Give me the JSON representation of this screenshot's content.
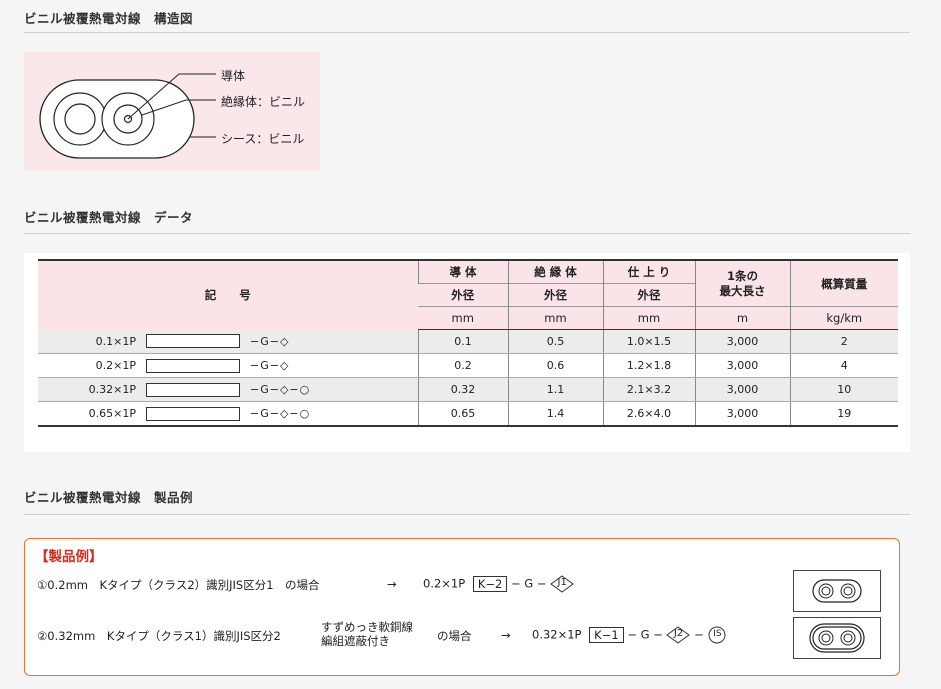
{
  "sections": {
    "structure_title": "ビニル被覆熱電対線　構造図",
    "data_title": "ビニル被覆熱電対線　データ",
    "example_title": "ビニル被覆熱電対線　製品例"
  },
  "diagram": {
    "labels": {
      "conductor": "導体",
      "insulation": "絶縁体：ビニル",
      "sheath": "シース：ビニル"
    }
  },
  "table": {
    "header": {
      "symbol": "記　　号",
      "conductor": "導 体",
      "insulation": "絶 縁 体",
      "finish": "仕 上 り",
      "max_length": "1条の\n最大長さ",
      "max_length_l1": "1条の",
      "max_length_l2": "最大長さ",
      "weight": "概算質量",
      "outer_dia": "外径",
      "unit_mm": "mm",
      "unit_m": "m",
      "unit_kgkm": "kg/km"
    },
    "rows": [
      {
        "code": "0.1×1P",
        "suffix": "−G−◇",
        "conductor": "0.1",
        "insulation": "0.5",
        "finish": "1.0×1.5",
        "length": "3,000",
        "weight": "2"
      },
      {
        "code": "0.2×1P",
        "suffix": "−G−◇",
        "conductor": "0.2",
        "insulation": "0.6",
        "finish": "1.2×1.8",
        "length": "3,000",
        "weight": "4"
      },
      {
        "code": "0.32×1P",
        "suffix": "−G−◇−○",
        "conductor": "0.32",
        "insulation": "1.1",
        "finish": "2.1×3.2",
        "length": "3,000",
        "weight": "10"
      },
      {
        "code": "0.65×1P",
        "suffix": "−G−◇−○",
        "conductor": "0.65",
        "insulation": "1.4",
        "finish": "2.6×4.0",
        "length": "3,000",
        "weight": "19"
      }
    ]
  },
  "example": {
    "heading": "【製品例】",
    "ex1": {
      "desc": "①0.2mm　Kタイプ（クラス2）識別JIS区分1　の場合",
      "arrow": "→",
      "code": "0.2×1P",
      "k": "K−2",
      "mid": "− G −",
      "j": "J1"
    },
    "ex2": {
      "desc": "②0.32mm　Kタイプ（クラス1）識別JIS区分2",
      "note1": "すずめっき軟銅線",
      "note2": "編組遮蔽付き",
      "case": "の場合",
      "arrow": "→",
      "code": "0.32×1P",
      "k": "K−1",
      "mid": "− G −",
      "j": "J2",
      "dash": "−",
      "is": "IS"
    }
  }
}
